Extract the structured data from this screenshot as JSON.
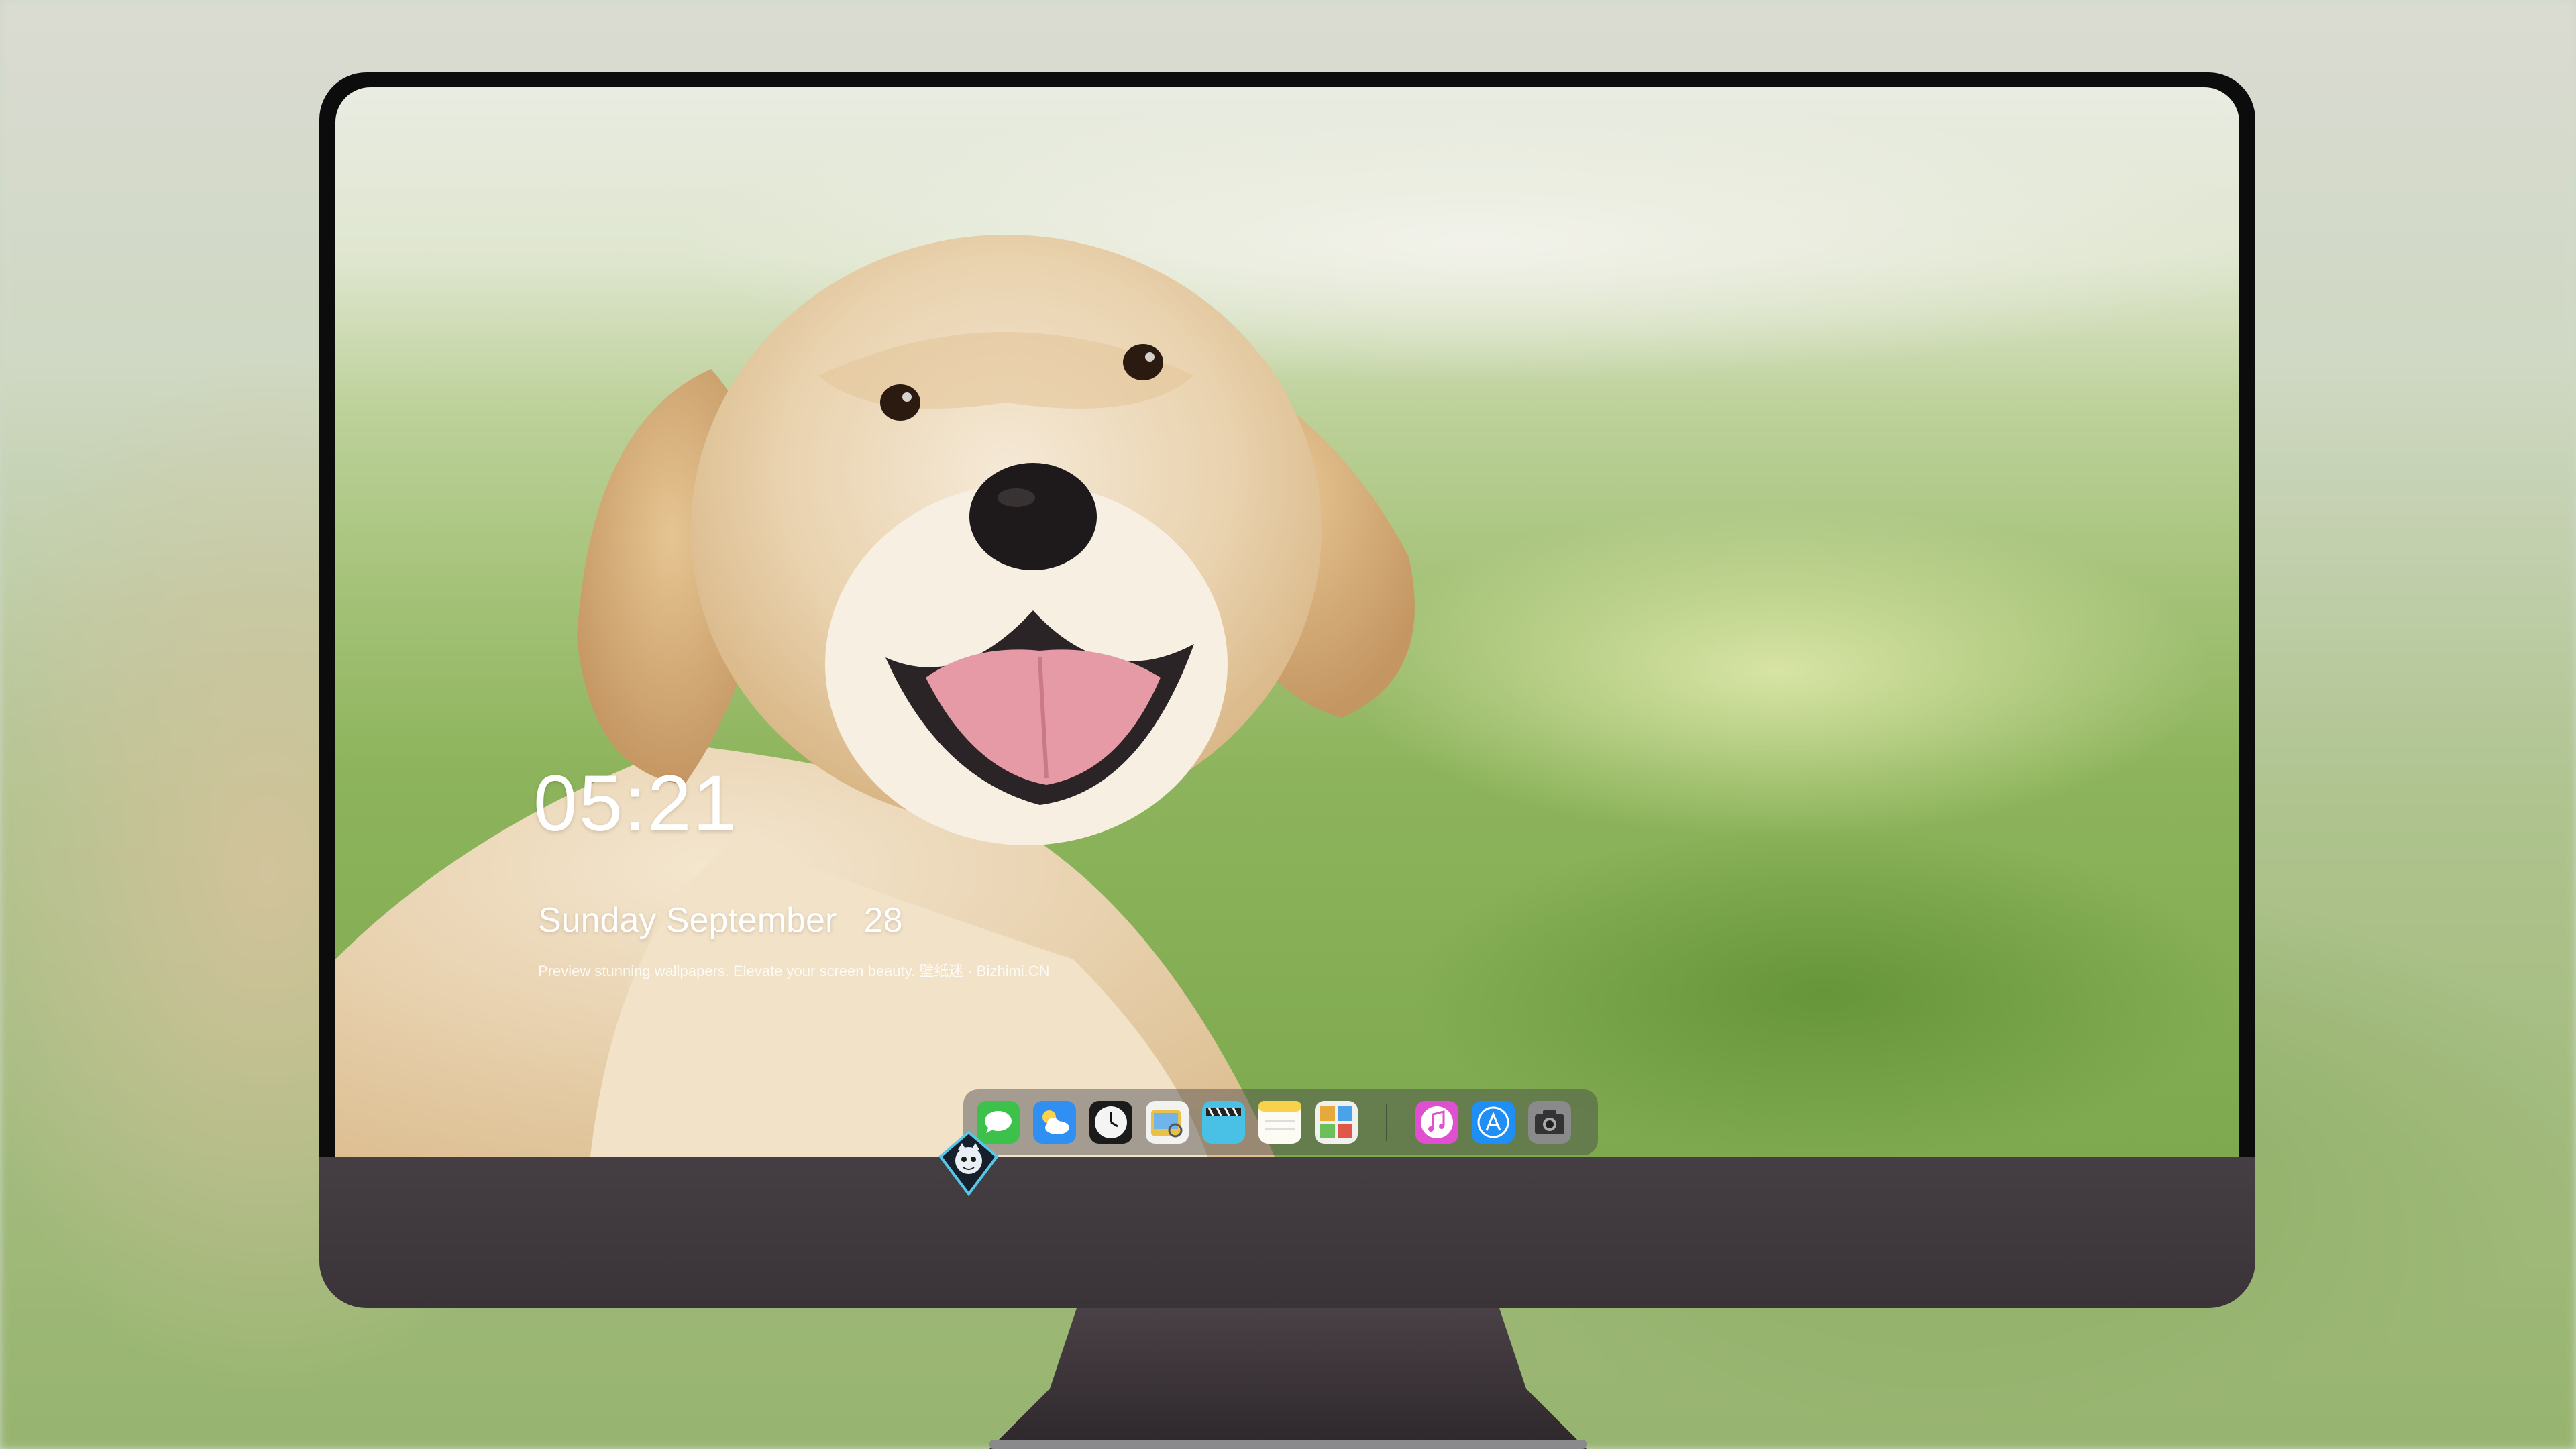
{
  "lock_screen": {
    "time": "05:21",
    "weekday": "Sunday",
    "month": "September",
    "day": "28",
    "tagline": "Preview stunning wallpapers. Elevate your screen beauty. 壁纸迷 · Bizhimi.CN"
  },
  "dock": {
    "apps": [
      {
        "icon": "messages-icon",
        "color": "#3cc24a"
      },
      {
        "icon": "weather-icon",
        "color": "#2f8ff2"
      },
      {
        "icon": "clock-icon",
        "color": "#f2f2f2"
      },
      {
        "icon": "preview-icon",
        "color": "#e8c04a"
      },
      {
        "icon": "video-editor-icon",
        "color": "#49c0e6"
      },
      {
        "icon": "notes-icon",
        "color": "#f7d24a"
      },
      {
        "icon": "photo-gallery-icon",
        "color": "#e7a83c"
      }
    ],
    "pinned": [
      {
        "icon": "music-icon",
        "color": "#e04fd0"
      },
      {
        "icon": "app-store-icon",
        "color": "#1f8ff5"
      },
      {
        "icon": "camera-icon",
        "color": "#8a8a8c"
      }
    ]
  },
  "chin_logo": "mascot-logo"
}
